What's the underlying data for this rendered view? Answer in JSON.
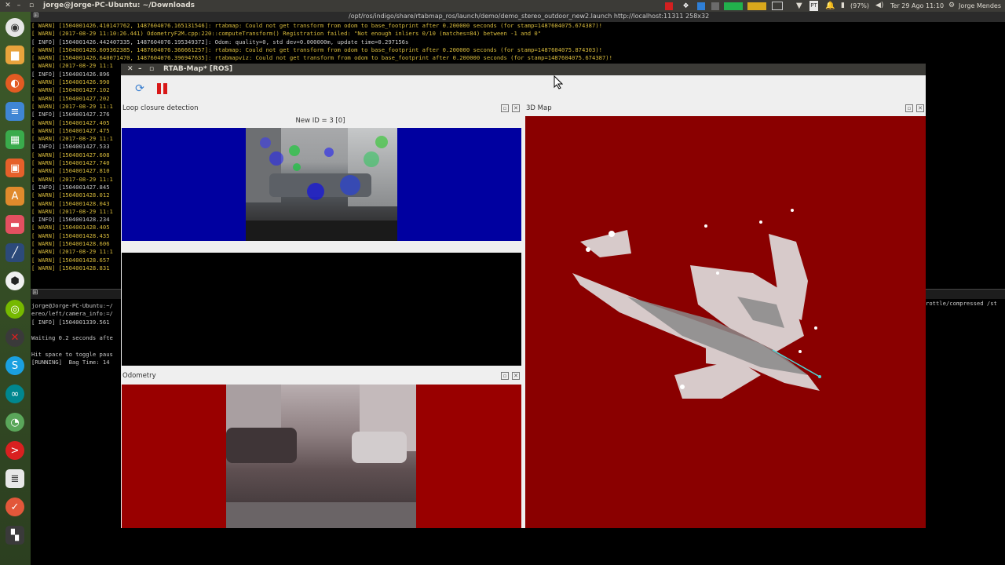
{
  "topbar": {
    "window_title": "jorge@Jorge-PC-Ubuntu: ~/Downloads",
    "battery": "(97%)",
    "datetime": "Ter 29 Ago 11:10",
    "user": "Jorge Mendes"
  },
  "terminal": {
    "title": "/opt/ros/indigo/share/rtabmap_ros/launch/demo/demo_stereo_outdoor_new2.launch http://localhost:11311 258x32",
    "lines": [
      "[ WARN] [1504001426.410147762, 1487604076.165131546]: rtabmap: Could not get transform from odom to base_footprint after 0.200000 seconds (for stamp=1487604075.674387)!",
      "[ WARN] (2017-08-29 11:10:26.441) OdometryF2M.cpp:220::computeTransform() Registration failed: \"Not enough inliers 0/10 (matches=84) between -1 and 0\"",
      "[ INFO] [1504001426.442407335, 1487604076.195349372]: Odom: quality=0, std dev=0.000000m, update time=0.297156s",
      "[ WARN] [1504001426.609362385, 1487604076.366661257]: rtabmap: Could not get transform from odom to base_footprint after 0.200000 seconds (for stamp=1487604075.874303)!",
      "[ WARN] [1504001426.640071470, 1487604076.396947635]: rtabmapviz: Could not get transform from odom to base_footprint after 0.200000 seconds (for stamp=1487604075.674387)!",
      "[ WARN] (2017-08-29 11:1",
      "[ INFO] [1504001426.896",
      "[ WARN] [1504001426.990",
      "[ WARN] [1504001427.102",
      "[ WARN] [1504001427.202",
      "[ WARN] (2017-08-29 11:1",
      "[ INFO] [1504001427.276",
      "[ WARN] [1504001427.405",
      "[ WARN] [1504001427.475",
      "[ WARN] (2017-08-29 11:1",
      "[ INFO] [1504001427.533",
      "[ WARN] [1504001427.608",
      "[ WARN] [1504001427.740",
      "[ WARN] [1504001427.810",
      "[ WARN] (2017-08-29 11:1",
      "[ INFO] [1504001427.845",
      "[ WARN] [1504001428.012",
      "[ WARN] [1504001428.043",
      "[ WARN] (2017-08-29 11:1",
      "[ INFO] [1504001428.234",
      "[ WARN] [1504001428.405",
      "[ WARN] [1504001428.435",
      "[ WARN] [1504001428.606",
      "[ WARN] (2017-08-29 11:1",
      "[ WARN] [1504001428.657",
      "[ WARN] [1504001428.831"
    ],
    "lower_lines": [
      "jorge@Jorge-PC-Ubuntu:~/",
      "ereo/left/camera_info:=/",
      "[ INFO] [1504001339.561",
      "",
      "Waiting 0.2 seconds afte",
      "",
      "Hit space to toggle paus",
      "[RUNNING]  Bag Time: 14"
    ],
    "right_fragment": "rottle/compressed /st"
  },
  "rtabmap": {
    "window_title": "RTAB-Map* [ROS]",
    "loop_closure": {
      "title": "Loop closure detection",
      "new_id_label": "New ID = 3 [0]"
    },
    "odometry": {
      "title": "Odometry"
    },
    "map3d": {
      "title": "3D Map"
    },
    "colors": {
      "loop_bg": "#0000a0",
      "odom_bg": "#990000",
      "map_bg": "#8a0000"
    }
  },
  "launcher": {
    "icons": [
      "dash-icon",
      "files-icon",
      "firefox-icon",
      "writer-icon",
      "calc-icon",
      "impress-icon",
      "software-center-icon",
      "app-icon",
      "pen-icon",
      "cube-icon",
      "nvidia-icon",
      "rviz-icon",
      "skype-icon",
      "arduino-icon",
      "green-app-icon",
      "red-app-icon",
      "text-editor-icon",
      "update-icon",
      "workspace-icon"
    ]
  }
}
